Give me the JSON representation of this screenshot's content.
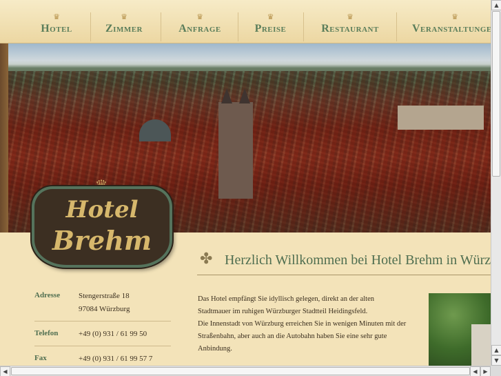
{
  "nav": {
    "items": [
      {
        "label": "Hotel"
      },
      {
        "label": "Zimmer"
      },
      {
        "label": "Anfrage"
      },
      {
        "label": "Preise"
      },
      {
        "label": "Restaurant"
      },
      {
        "label": "Veranstaltungen"
      }
    ],
    "crown_glyph": "♛"
  },
  "logo": {
    "line1": "Hotel",
    "line2": "Brehm",
    "crown_glyph": "♛"
  },
  "welcome": {
    "heading": "Herzlich Willkommen bei Hotel Brehm in Würzburg",
    "icon": "clover-icon",
    "icon_glyph": "✤"
  },
  "contact": {
    "address_key": "Adresse",
    "address_line1": "Stengerstraße 18",
    "address_line2": "97084 Würzburg",
    "phone_key": "Telefon",
    "phone_value": "+49 (0) 931 / 61 99 50",
    "fax_key": "Fax",
    "fax_value": "+49 (0) 931 / 61 99 57 7"
  },
  "intro": {
    "line1": "Das Hotel empfängt Sie idyllisch gelegen, direkt an der alten",
    "line2": "Stadtmauer im ruhigen Würzburger Stadtteil Heidingsfeld.",
    "line3": "Die Innenstadt von Würzburg erreichen Sie in wenigen Minuten mit der",
    "line4": "Straßenbahn, aber auch an die Autobahn haben Sie eine sehr gute",
    "line5": "Anbindung."
  },
  "scrollbar": {
    "up": "▲",
    "down": "▼",
    "left": "◀",
    "right": "▶"
  },
  "colors": {
    "accent": "#4f6e50",
    "background": "#f3e3b9",
    "crown": "#b5914a"
  }
}
